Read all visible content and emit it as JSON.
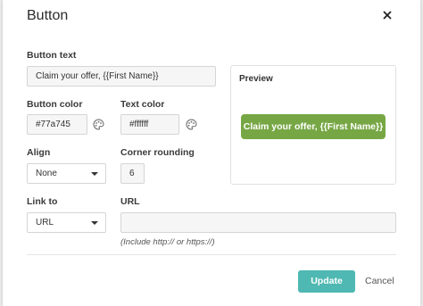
{
  "dialog": {
    "title": "Button",
    "close_icon": "close-icon"
  },
  "form": {
    "button_text": {
      "label": "Button text",
      "value": "Claim your offer, {{First Name}}"
    },
    "button_color": {
      "label": "Button color",
      "value": "#77a745",
      "icon": "palette-icon"
    },
    "text_color": {
      "label": "Text color",
      "value": "#ffffff",
      "icon": "palette-icon"
    },
    "align": {
      "label": "Align",
      "value": "None"
    },
    "corner_rounding": {
      "label": "Corner rounding",
      "value": "6"
    },
    "link_to": {
      "label": "Link to",
      "value": "URL"
    },
    "url": {
      "label": "URL",
      "value": "",
      "hint": "(Include http:// or https://)"
    }
  },
  "preview": {
    "title": "Preview",
    "button_label": "Claim your offer, {{First Name}}"
  },
  "footer": {
    "update_label": "Update",
    "cancel_label": "Cancel"
  },
  "colors": {
    "accent": "#4fb8b2",
    "preview_button": "#77a745",
    "preview_text": "#ffffff"
  }
}
